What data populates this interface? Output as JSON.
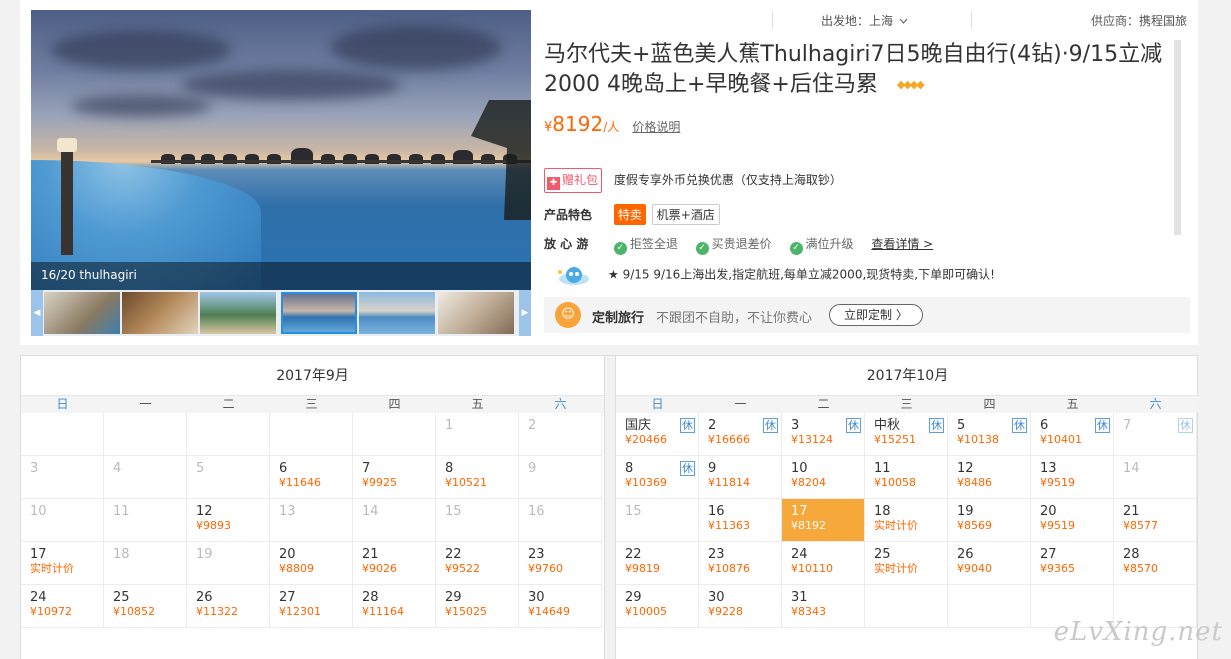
{
  "gallery": {
    "caption": "16/20 thulhagiri"
  },
  "header": {
    "depart_label": "出发地：上海",
    "supplier_label": "供应商：携程国旅",
    "title": "马尔代夫+蓝色美人蕉Thulhagiri7日5晚自由行(4钻)·9/15立减2000 4晚岛上+早晚餐+后住马累",
    "diamond_icon": "diamond-icon"
  },
  "price": {
    "currency": "¥",
    "value": "8192",
    "unit": "/人",
    "note": "价格说明"
  },
  "gift": {
    "badge": "赠礼包",
    "text": "度假专享外币兑换优惠（仅支持上海取钞）"
  },
  "features": {
    "label": "产品特色",
    "tags": [
      "特卖",
      "机票+酒店"
    ]
  },
  "worry_free": {
    "label": "放 心 游",
    "items": [
      "拒签全退",
      "买贵退差价",
      "满位升级"
    ],
    "more": "查看详情 >"
  },
  "notice": "★ 9/15 9/16上海出发,指定航班,每单立减2000,现货特卖,下单即可确认!",
  "custom": {
    "title": "定制旅行",
    "desc": "不跟团不自助，不让你费心",
    "button": "立即定制 〉"
  },
  "weekdays": [
    "日",
    "一",
    "二",
    "三",
    "四",
    "五",
    "六"
  ],
  "holiday_mark": "休",
  "calendars": [
    {
      "title": "2017年9月",
      "weeks": [
        [
          {
            "d": ""
          },
          {
            "d": ""
          },
          {
            "d": ""
          },
          {
            "d": ""
          },
          {
            "d": ""
          },
          {
            "d": "1",
            "dim": true
          },
          {
            "d": "2",
            "dim": true
          }
        ],
        [
          {
            "d": "3",
            "dim": true
          },
          {
            "d": "4",
            "dim": true
          },
          {
            "d": "5",
            "dim": true
          },
          {
            "d": "6",
            "p": "¥11646"
          },
          {
            "d": "7",
            "p": "¥9925"
          },
          {
            "d": "8",
            "p": "¥10521"
          },
          {
            "d": "9",
            "dim": true
          }
        ],
        [
          {
            "d": "10",
            "dim": true
          },
          {
            "d": "11",
            "dim": true
          },
          {
            "d": "12",
            "p": "¥9893"
          },
          {
            "d": "13",
            "dim": true
          },
          {
            "d": "14",
            "dim": true
          },
          {
            "d": "15",
            "dim": true
          },
          {
            "d": "16",
            "dim": true
          }
        ],
        [
          {
            "d": "17",
            "p": "实时计价"
          },
          {
            "d": "18",
            "dim": true
          },
          {
            "d": "19",
            "dim": true
          },
          {
            "d": "20",
            "p": "¥8809"
          },
          {
            "d": "21",
            "p": "¥9026"
          },
          {
            "d": "22",
            "p": "¥9522"
          },
          {
            "d": "23",
            "p": "¥9760"
          }
        ],
        [
          {
            "d": "24",
            "p": "¥10972"
          },
          {
            "d": "25",
            "p": "¥10852"
          },
          {
            "d": "26",
            "p": "¥11322"
          },
          {
            "d": "27",
            "p": "¥12301"
          },
          {
            "d": "28",
            "p": "¥11164"
          },
          {
            "d": "29",
            "p": "¥15025"
          },
          {
            "d": "30",
            "p": "¥14649"
          }
        ]
      ]
    },
    {
      "title": "2017年10月",
      "weeks": [
        [
          {
            "d": "国庆",
            "p": "¥20466",
            "xiu": true
          },
          {
            "d": "2",
            "p": "¥16666",
            "xiu": true
          },
          {
            "d": "3",
            "p": "¥13124",
            "xiu": true
          },
          {
            "d": "中秋",
            "p": "¥15251",
            "xiu": true
          },
          {
            "d": "5",
            "p": "¥10138",
            "xiu": true
          },
          {
            "d": "6",
            "p": "¥10401",
            "xiu": true
          },
          {
            "d": "7",
            "dim": true,
            "xiu": true,
            "xiu_light": true
          }
        ],
        [
          {
            "d": "8",
            "p": "¥10369",
            "xiu": true
          },
          {
            "d": "9",
            "p": "¥11814"
          },
          {
            "d": "10",
            "p": "¥8204"
          },
          {
            "d": "11",
            "p": "¥10058"
          },
          {
            "d": "12",
            "p": "¥8486"
          },
          {
            "d": "13",
            "p": "¥9519"
          },
          {
            "d": "14",
            "dim": true
          }
        ],
        [
          {
            "d": "15",
            "dim": true
          },
          {
            "d": "16",
            "p": "¥11363"
          },
          {
            "d": "17",
            "p": "¥8192",
            "sel": true
          },
          {
            "d": "18",
            "p": "实时计价"
          },
          {
            "d": "19",
            "p": "¥8569"
          },
          {
            "d": "20",
            "p": "¥9519"
          },
          {
            "d": "21",
            "p": "¥8577"
          }
        ],
        [
          {
            "d": "22",
            "p": "¥9819"
          },
          {
            "d": "23",
            "p": "¥10876"
          },
          {
            "d": "24",
            "p": "¥10110"
          },
          {
            "d": "25",
            "p": "实时计价"
          },
          {
            "d": "26",
            "p": "¥9040"
          },
          {
            "d": "27",
            "p": "¥9365"
          },
          {
            "d": "28",
            "p": "¥8570"
          }
        ],
        [
          {
            "d": "29",
            "p": "¥10005"
          },
          {
            "d": "30",
            "p": "¥9228"
          },
          {
            "d": "31",
            "p": "¥8343"
          },
          {
            "d": ""
          },
          {
            "d": ""
          },
          {
            "d": ""
          },
          {
            "d": ""
          }
        ]
      ]
    }
  ],
  "watermark": "eLvXing.net"
}
